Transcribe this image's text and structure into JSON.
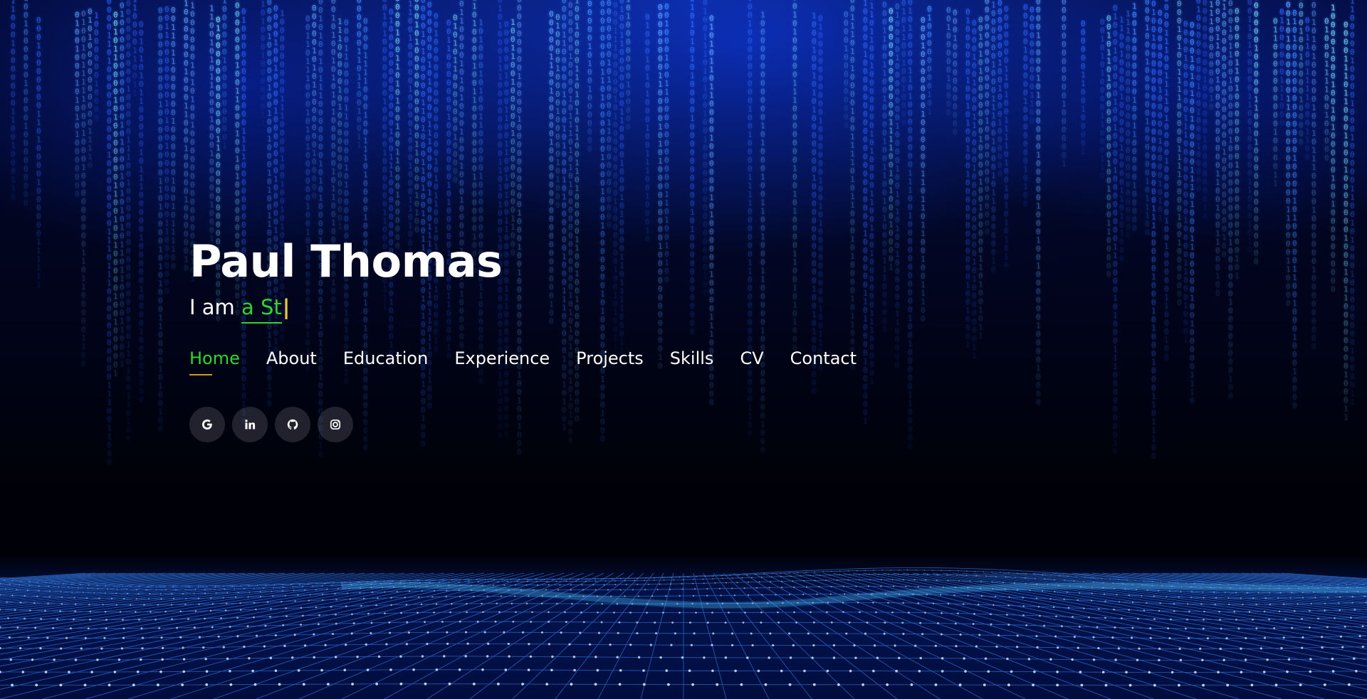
{
  "hero": {
    "name": "Paul Thomas",
    "typed_prefix": "I am ",
    "typed_text": "a St",
    "typed_cursor": "|"
  },
  "nav": {
    "items": [
      {
        "label": "Home",
        "active": true
      },
      {
        "label": "About",
        "active": false
      },
      {
        "label": "Education",
        "active": false
      },
      {
        "label": "Experience",
        "active": false
      },
      {
        "label": "Projects",
        "active": false
      },
      {
        "label": "Skills",
        "active": false
      },
      {
        "label": "CV",
        "active": false
      },
      {
        "label": "Contact",
        "active": false
      }
    ]
  },
  "social": {
    "links": [
      {
        "icon": "google-icon"
      },
      {
        "icon": "linkedin-icon"
      },
      {
        "icon": "github-icon"
      },
      {
        "icon": "instagram-icon"
      }
    ]
  },
  "colors": {
    "accent": "#2ed62e",
    "nav_underline": "#c99a28",
    "cursor": "#e8c74a",
    "background": "#00010a",
    "rain": "#3a7bff"
  }
}
